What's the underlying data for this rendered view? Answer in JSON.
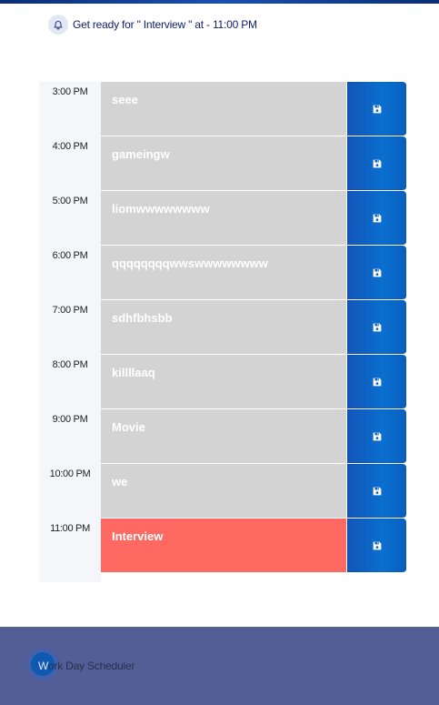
{
  "notification": {
    "icon": "bell-icon",
    "text": "Get ready for \" Interview \" at - 11:00 PM"
  },
  "schedule": {
    "rows": [
      {
        "hour": "3:00 PM",
        "text": "seee",
        "state": "past"
      },
      {
        "hour": "4:00 PM",
        "text": "gameingw",
        "state": "past"
      },
      {
        "hour": "5:00 PM",
        "text": "liomwwwwwwww",
        "state": "past"
      },
      {
        "hour": "6:00 PM",
        "text": "qqqqqqqqwwswwwwwwww",
        "state": "past"
      },
      {
        "hour": "7:00 PM",
        "text": "sdhfbhsbb",
        "state": "past"
      },
      {
        "hour": "8:00 PM",
        "text": "killllaaq",
        "state": "past"
      },
      {
        "hour": "9:00 PM",
        "text": "Movie",
        "state": "past"
      },
      {
        "hour": "10:00 PM",
        "text": "we",
        "state": "past"
      },
      {
        "hour": "11:00 PM",
        "text": "Interview",
        "state": "present"
      }
    ],
    "save_icon": "save-icon"
  },
  "colors": {
    "past": "#d3d3d3",
    "present": "#ff6961",
    "save_button": "#0a6fcf",
    "footer": "#545e96"
  },
  "footer": {
    "first_letter": "W",
    "rest": "ork Day Scheduler"
  }
}
